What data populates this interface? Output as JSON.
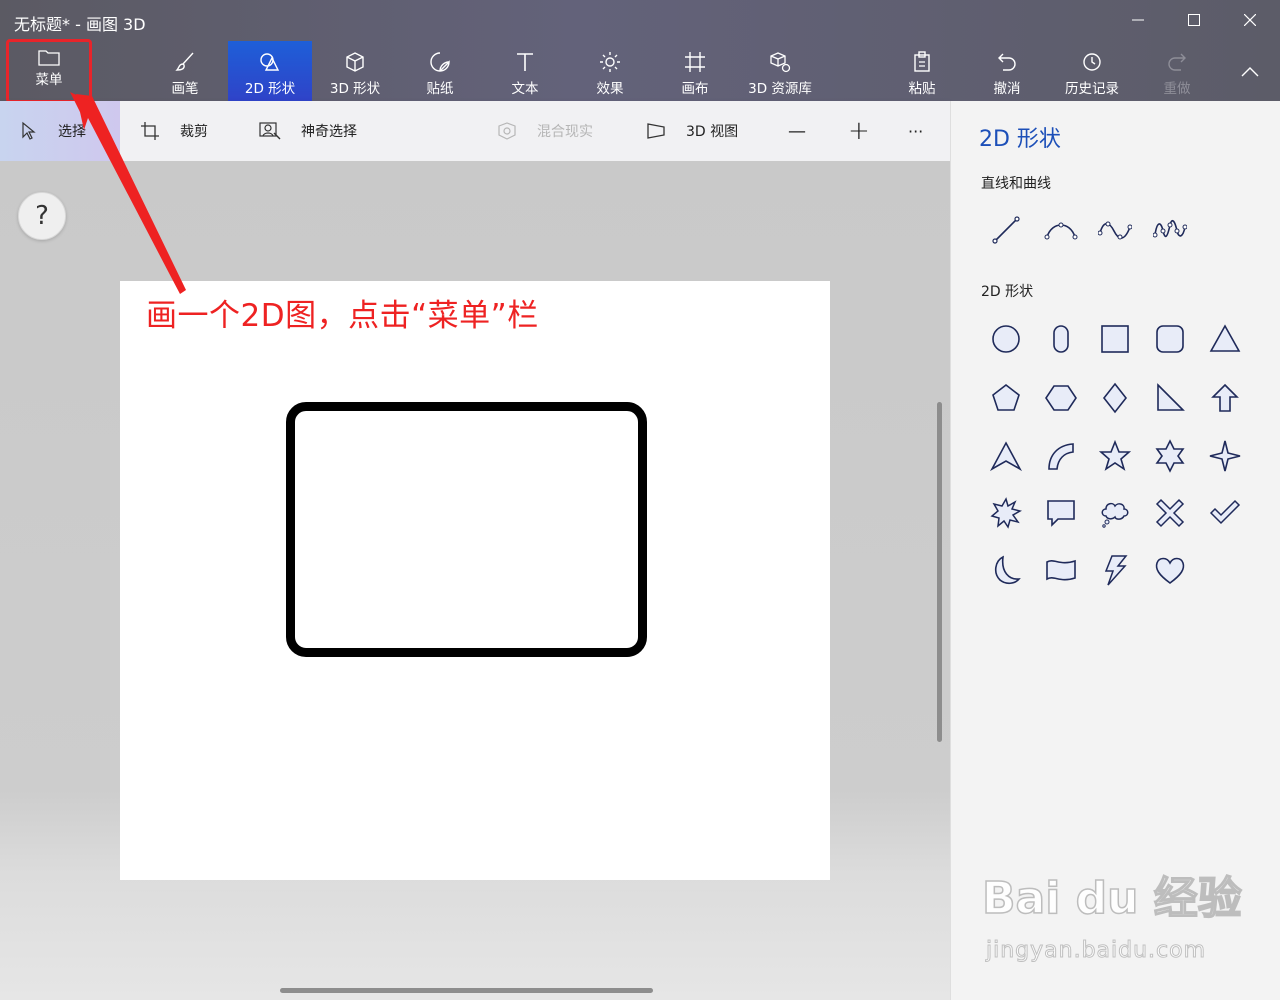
{
  "window": {
    "title": "无标题* - 画图 3D"
  },
  "colors": {
    "accent": "#1e5fd8",
    "panel_title": "#1c4fb8",
    "annotation": "#ee2222",
    "shape_stroke": "#1f2a5a"
  },
  "ribbon": {
    "menu_label": "菜单",
    "tools": [
      {
        "label": "画笔",
        "icon": "brush-icon"
      },
      {
        "label": "2D 形状",
        "icon": "2d-shapes-icon",
        "active": true
      },
      {
        "label": "3D 形状",
        "icon": "3d-cube-icon"
      },
      {
        "label": "贴纸",
        "icon": "sticker-icon"
      },
      {
        "label": "文本",
        "icon": "text-icon"
      },
      {
        "label": "效果",
        "icon": "effects-sun-icon"
      },
      {
        "label": "画布",
        "icon": "canvas-crop-icon"
      },
      {
        "label": "3D 资源库",
        "icon": "3d-library-icon"
      }
    ],
    "actions": [
      {
        "label": "粘贴",
        "icon": "paste-icon"
      },
      {
        "label": "撤消",
        "icon": "undo-icon"
      },
      {
        "label": "历史记录",
        "icon": "history-icon"
      },
      {
        "label": "重做",
        "icon": "redo-icon",
        "disabled": true
      }
    ]
  },
  "subbar": {
    "select": "选择",
    "crop": "裁剪",
    "magic_select": "神奇选择",
    "mixed_reality": "混合现实",
    "view_3d": "3D 视图",
    "zoom_out": "—",
    "zoom_in": "+",
    "more": "···"
  },
  "help": "?",
  "annotation": {
    "text": "画一个2D图，点击“菜单”栏"
  },
  "panel": {
    "title": "2D 形状",
    "lines_section": "直线和曲线",
    "shapes_section": "2D 形状",
    "lines": [
      "line-icon",
      "curve-1-icon",
      "curve-2-icon",
      "curve-3-icon"
    ],
    "shapes": [
      "circle-icon",
      "capsule-icon",
      "square-icon",
      "rounded-square-icon",
      "triangle-icon",
      "pentagon-icon",
      "hexagon-icon",
      "diamond-icon",
      "right-triangle-icon",
      "arrow-up-icon",
      "arrowhead-icon",
      "quarter-circle-icon",
      "star-5-icon",
      "star-6-icon",
      "star-4-icon",
      "burst-icon",
      "speech-bubble-icon",
      "thought-bubble-icon",
      "cross-icon",
      "check-icon",
      "moon-icon",
      "banner-icon",
      "lightning-icon",
      "heart-icon"
    ]
  },
  "watermark": {
    "main": "Bai du 经验",
    "sub": "jingyan.baidu.com"
  }
}
